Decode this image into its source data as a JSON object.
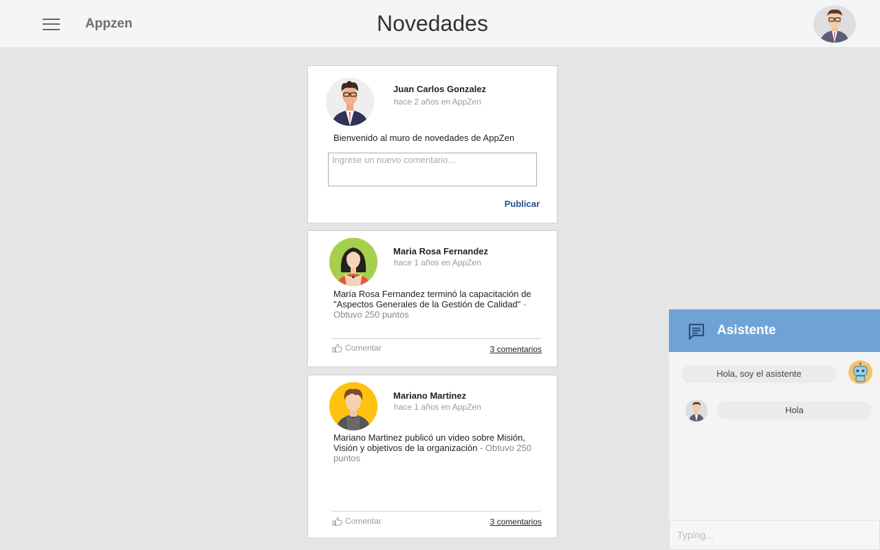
{
  "header": {
    "brand": "Appzen",
    "title": "Novedades",
    "menu_icon": "hamburger-menu-icon",
    "avatar_icon": "user-avatar-icon"
  },
  "composer_post": {
    "author": "Juan Carlos Gonzalez",
    "meta": "hace 2 años en AppZen",
    "text": "Bienvenido al muro de novedades de AppZen",
    "comment_placeholder": "Ingrese un nuevo comentario...",
    "publish_label": "Publicar"
  },
  "posts": [
    {
      "author": "Maria Rosa Fernandez",
      "meta": "hace 1 años en AppZen",
      "text": "María Rosa Fernandez terminó la capacitación de \"Aspectos Generales de la Gestión de Calidad\"",
      "points": " - Obtuvo  250 puntos",
      "comment_label": "Comentar",
      "comments_count": "3 comentarios"
    },
    {
      "author": "Mariano Martinez",
      "meta": "hace 1 años en AppZen",
      "text": "Mariano Martinez publicó un video sobre Misión, Visión y objetivos de la organización",
      "points": " - Obtuvo  250 puntos",
      "comment_label": "Comentar",
      "comments_count": "3 comentarios"
    }
  ],
  "assistant": {
    "title": "Asistente",
    "icon": "chat-icon",
    "messages": [
      {
        "from": "bot",
        "text": "Hola, soy el asistente"
      },
      {
        "from": "user",
        "text": "Hola"
      }
    ],
    "input_placeholder": "Typing..."
  },
  "colors": {
    "accent": "#6fa3d8",
    "link": "#1e4e8c",
    "background": "#e5e5e5"
  }
}
